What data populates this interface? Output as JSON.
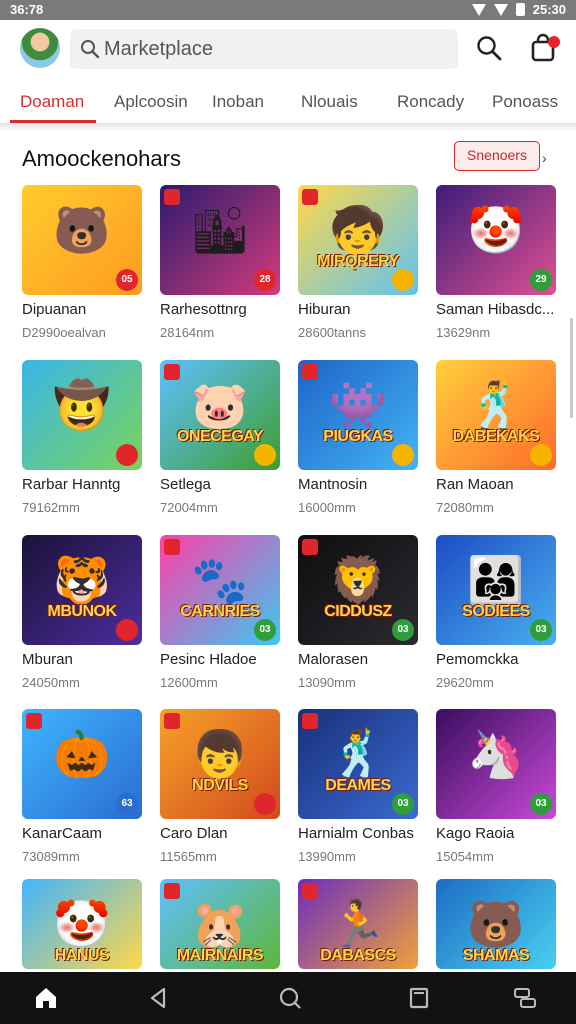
{
  "status": {
    "time": "36:78",
    "right_time": "25:30"
  },
  "search": {
    "placeholder": "Marketplace"
  },
  "tabs": [
    {
      "label": "Doaman",
      "active": true
    },
    {
      "label": "Aplcoosin",
      "active": false
    },
    {
      "label": "Inoban",
      "active": false
    },
    {
      "label": "Nlouais",
      "active": false
    },
    {
      "label": "Roncady",
      "active": false
    },
    {
      "label": "Ponoass",
      "active": false
    }
  ],
  "section": {
    "title": "Amoockenohars",
    "button": "Snenoers"
  },
  "cards": [
    {
      "title": "Dipuanan",
      "meta": "D2990oealvan",
      "badge": "05",
      "banner": "",
      "symbol": "🐻",
      "bg1": "#ffcc2e",
      "bg2": "#ff9a1f",
      "badge_color": "#e0262c"
    },
    {
      "title": "Rarhesottnrg",
      "meta": "28164nm",
      "badge": "28",
      "banner": "",
      "symbol": "🏙",
      "bg1": "#2a1b6e",
      "bg2": "#d43b7a",
      "badge_color": "#e0262c"
    },
    {
      "title": "Hiburan",
      "meta": "28600tanns",
      "badge": "",
      "banner": "MIRQRERY",
      "symbol": "🧒",
      "bg1": "#ffd84a",
      "bg2": "#5ec3f0",
      "badge_color": "#f4b400"
    },
    {
      "title": "Saman Hibasdc...",
      "meta": "13629nm",
      "badge": "29",
      "banner": "",
      "symbol": "🤡",
      "bg1": "#3b1d7a",
      "bg2": "#e05090",
      "badge_color": "#2e9d3a"
    },
    {
      "title": "Rarbar Hanntg",
      "meta": "79162mm",
      "badge": "",
      "banner": "",
      "symbol": "🤠",
      "bg1": "#38b6e8",
      "bg2": "#7bd35a",
      "badge_color": "#e0262c"
    },
    {
      "title": "Setlega",
      "meta": "72004mm",
      "badge": "",
      "banner": "ONECEGAY",
      "symbol": "🐷",
      "bg1": "#5ec0ff",
      "bg2": "#3f9d2e",
      "badge_color": "#f4b400"
    },
    {
      "title": "Mantnosin",
      "meta": "16000mm",
      "badge": "",
      "banner": "PIUGKAS",
      "symbol": "👾",
      "bg1": "#1e63c7",
      "bg2": "#43b4f5",
      "badge_color": "#f4b400"
    },
    {
      "title": "Ran Maoan",
      "meta": "72080mm",
      "badge": "",
      "banner": "DABEKAKS",
      "symbol": "🕺",
      "bg1": "#ffcf3d",
      "bg2": "#ff6a2b",
      "badge_color": "#f4b400"
    },
    {
      "title": "Mburan",
      "meta": "24050mm",
      "badge": "",
      "banner": "MBUNOK",
      "symbol": "🐯",
      "bg1": "#1b1238",
      "bg2": "#4c2d9e",
      "badge_color": "#e0262c"
    },
    {
      "title": "Pesinc Hladoe",
      "meta": "12600mm",
      "badge": "03",
      "banner": "CARNRIES",
      "symbol": "🐾",
      "bg1": "#ff3fa8",
      "bg2": "#3cc8f0",
      "badge_color": "#2e9d3a"
    },
    {
      "title": "Malorasen",
      "meta": "13090mm",
      "badge": "03",
      "banner": "CIDDUSZ",
      "symbol": "🦁",
      "bg1": "#0e0e10",
      "bg2": "#2a2a30",
      "badge_color": "#2e9d3a"
    },
    {
      "title": "Pemomckka",
      "meta": "29620mm",
      "badge": "03",
      "banner": "SODIEES",
      "symbol": "👨‍👩‍👧",
      "bg1": "#1d4cc4",
      "bg2": "#49b0ef",
      "badge_color": "#2e9d3a"
    },
    {
      "title": "KanarCaam",
      "meta": "73089mm",
      "badge": "63",
      "banner": "",
      "symbol": "🎃",
      "bg1": "#3fb5ff",
      "bg2": "#2a6ccf",
      "badge_color": "#2a6ccf"
    },
    {
      "title": "Caro Dlan",
      "meta": "11565mm",
      "badge": "",
      "banner": "NDVILS",
      "symbol": "👦",
      "bg1": "#f7a12a",
      "bg2": "#d14a1c",
      "badge_color": "#e0262c"
    },
    {
      "title": "Harnialm Conbas",
      "meta": "13990mm",
      "badge": "03",
      "banner": "DEAMES",
      "symbol": "🕺",
      "bg1": "#18307a",
      "bg2": "#3b6ad1",
      "badge_color": "#2e9d3a"
    },
    {
      "title": "Kago Raoia",
      "meta": "15054mm",
      "badge": "03",
      "banner": "",
      "symbol": "🦄",
      "bg1": "#3a0d5e",
      "bg2": "#c84ad8",
      "badge_color": "#2e9d3a"
    },
    {
      "title": "",
      "meta": "",
      "badge": "",
      "banner": "HANUS",
      "symbol": "🤡",
      "bg1": "#3fb5ff",
      "bg2": "#ffd84a",
      "badge_color": "#2e9d3a"
    },
    {
      "title": "",
      "meta": "",
      "badge": "",
      "banner": "MAIRNAIRS",
      "symbol": "🐹",
      "bg1": "#5ec0ff",
      "bg2": "#5fb63a",
      "badge_color": "#2e9d3a"
    },
    {
      "title": "",
      "meta": "",
      "badge": "",
      "banner": "DABASCS",
      "symbol": "🏃",
      "bg1": "#6a2ec0",
      "bg2": "#f0a23a",
      "badge_color": "#2e9d3a"
    },
    {
      "title": "",
      "meta": "",
      "badge": "",
      "banner": "SHAMAS",
      "symbol": "🐻",
      "bg1": "#1d6cc4",
      "bg2": "#49d0ef",
      "badge_color": "#2e9d3a"
    }
  ],
  "icons": {
    "search": "magnifier-icon",
    "cart": "shopping-bag-icon",
    "nav": [
      "home-icon",
      "back-icon",
      "search-icon",
      "recents-icon",
      "switch-icon"
    ]
  },
  "colors": {
    "accent": "#d32f2f",
    "navbar": "#121212"
  }
}
